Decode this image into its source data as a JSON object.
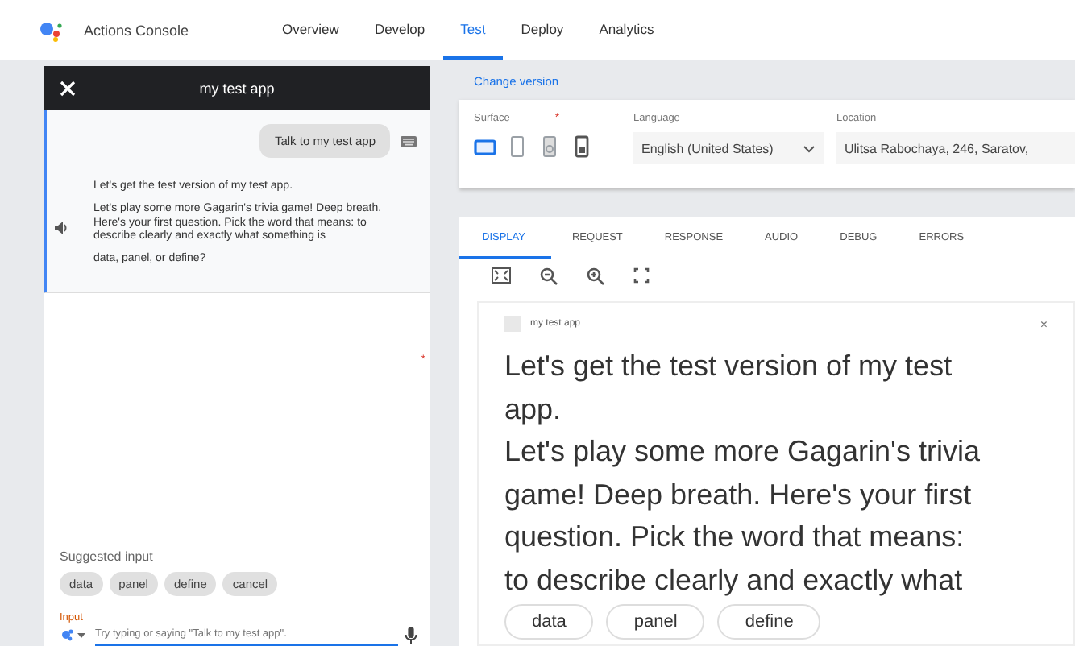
{
  "header": {
    "title": "Actions Console",
    "nav": [
      {
        "label": "Overview",
        "selected": false
      },
      {
        "label": "Develop",
        "selected": false
      },
      {
        "label": "Test",
        "selected": true
      },
      {
        "label": "Deploy",
        "selected": false
      },
      {
        "label": "Analytics",
        "selected": false
      }
    ]
  },
  "simulator": {
    "title": "my test app",
    "user_message": "Talk to my test app",
    "response": [
      "Let's get the test version of my test app.",
      "Let's play some more Gagarin's trivia game! Deep breath. Here's your first question. Pick the word that means: to describe clearly and exactly what something is",
      "data, panel, or define?"
    ],
    "suggested_label": "Suggested input",
    "suggestions": [
      "data",
      "panel",
      "define",
      "cancel"
    ],
    "input_label": "Input",
    "input_placeholder": "Try typing or saying \"Talk to my test app\"."
  },
  "change_version": "Change version",
  "settings": {
    "surface_label": "Surface",
    "required_mark": "*",
    "surfaces": [
      {
        "kind": "display",
        "selected": true
      },
      {
        "kind": "phone",
        "selected": false
      },
      {
        "kind": "speaker",
        "selected": false
      },
      {
        "kind": "device",
        "selected": false
      }
    ],
    "language_label": "Language",
    "language": "English (United States)",
    "location_label": "Location",
    "location": "Ulitsa Rabochaya, 246, Saratov,"
  },
  "tabs": [
    {
      "label": "DISPLAY",
      "selected": true
    },
    {
      "label": "REQUEST",
      "selected": false
    },
    {
      "label": "RESPONSE",
      "selected": false
    },
    {
      "label": "AUDIO",
      "selected": false
    },
    {
      "label": "DEBUG",
      "selected": false
    },
    {
      "label": "ERRORS",
      "selected": false
    }
  ],
  "display": {
    "app_name": "my test app",
    "close": "×",
    "lines": [
      "Let's get the test version of my test app.",
      "Let's play some more Gagarin's trivia game! Deep breath. Here's your first question. Pick the word that means: to describe clearly and exactly what"
    ],
    "chips": [
      "data",
      "panel",
      "define"
    ]
  }
}
